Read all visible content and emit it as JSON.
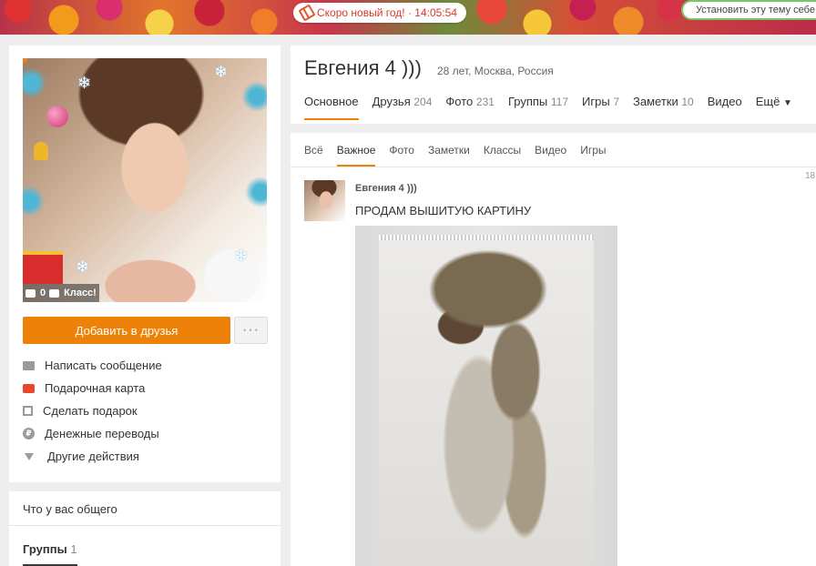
{
  "banner": {
    "countdown_text": "Скоро новый год! · 14:05:54",
    "theme_text": "Установить эту тему себе"
  },
  "profile": {
    "name": "Евгения 4 )))",
    "meta": "28 лет, Москва, Россия",
    "avatar_stats": {
      "comments": "0",
      "likes_label": "Класс!"
    },
    "add_friend_label": "Добавить в друзья",
    "more_label": "···",
    "actions": [
      {
        "label": "Написать сообщение",
        "icon": "mail-icon"
      },
      {
        "label": "Подарочная карта",
        "icon": "gift-card-icon"
      },
      {
        "label": "Сделать подарок",
        "icon": "gift-icon"
      },
      {
        "label": "Денежные переводы",
        "icon": "money-transfer-icon"
      },
      {
        "label": "Другие действия",
        "icon": "triangle-down-icon"
      }
    ]
  },
  "common": {
    "title": "Что у вас общего",
    "groups_label": "Группы",
    "groups_count": "1"
  },
  "nav": [
    {
      "label": "Основное",
      "count": ""
    },
    {
      "label": "Друзья",
      "count": "204"
    },
    {
      "label": "Фото",
      "count": "231"
    },
    {
      "label": "Группы",
      "count": "117"
    },
    {
      "label": "Игры",
      "count": "7"
    },
    {
      "label": "Заметки",
      "count": "10"
    },
    {
      "label": "Видео",
      "count": ""
    },
    {
      "label": "Ещё",
      "count": "",
      "caret": "▼"
    }
  ],
  "subnav": [
    "Всё",
    "Важное",
    "Фото",
    "Заметки",
    "Классы",
    "Видео",
    "Игры"
  ],
  "post": {
    "time": "18",
    "author": "Евгения 4 )))",
    "text": "ПРОДАМ ВЫШИТУЮ КАРТИНУ"
  },
  "colors": {
    "accent": "#ee8208",
    "page_bg": "#eeeeee"
  }
}
